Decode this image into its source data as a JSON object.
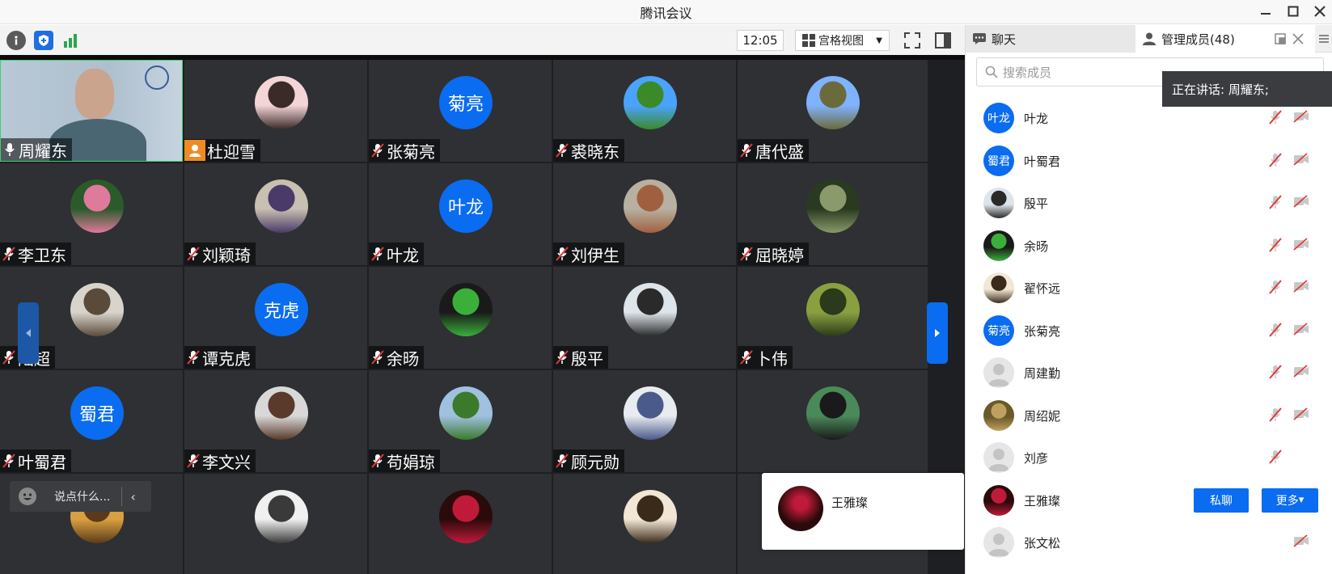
{
  "window": {
    "title": "腾讯会议"
  },
  "toolbar": {
    "time": "12:05",
    "view_label": "宫格视图"
  },
  "grid": {
    "tiles": [
      {
        "name": "周耀东",
        "mic": "on",
        "avatar": {
          "kind": "video"
        }
      },
      {
        "name": "杜迎雪",
        "mic": "none",
        "avatar": {
          "kind": "photo",
          "colors": [
            "#f3d5d8",
            "#3a2a28"
          ]
        }
      },
      {
        "name": "张菊亮",
        "mic": "off",
        "avatar": {
          "kind": "text",
          "text": "菊亮"
        }
      },
      {
        "name": "裘晓东",
        "mic": "off",
        "avatar": {
          "kind": "photo",
          "colors": [
            "#4aa3ff",
            "#3a8a2a"
          ]
        }
      },
      {
        "name": "唐代盛",
        "mic": "off",
        "avatar": {
          "kind": "photo",
          "colors": [
            "#7fb2ff",
            "#6b6a3a"
          ]
        }
      },
      {
        "name": "李卫东",
        "mic": "off",
        "avatar": {
          "kind": "photo",
          "colors": [
            "#2b5a2b",
            "#e07a9a"
          ]
        }
      },
      {
        "name": "刘颖琦",
        "mic": "off",
        "avatar": {
          "kind": "photo",
          "colors": [
            "#c8c0b0",
            "#4a3a6a"
          ]
        }
      },
      {
        "name": "叶龙",
        "mic": "off",
        "avatar": {
          "kind": "text",
          "text": "叶龙"
        }
      },
      {
        "name": "刘伊生",
        "mic": "off",
        "avatar": {
          "kind": "photo",
          "colors": [
            "#b8b0a0",
            "#a06040"
          ]
        }
      },
      {
        "name": "屈晓婷",
        "mic": "off",
        "avatar": {
          "kind": "photo",
          "colors": [
            "#2a3a20",
            "#8a9a6a"
          ]
        }
      },
      {
        "name": "陆超",
        "mic": "off",
        "avatar": {
          "kind": "photo",
          "colors": [
            "#d8d4cc",
            "#5a4a3a"
          ]
        }
      },
      {
        "name": "谭克虎",
        "mic": "off",
        "avatar": {
          "kind": "text",
          "text": "克虎"
        }
      },
      {
        "name": "余旸",
        "mic": "off",
        "avatar": {
          "kind": "photo",
          "colors": [
            "#1a1a1a",
            "#3ab03a"
          ]
        }
      },
      {
        "name": "殷平",
        "mic": "off",
        "avatar": {
          "kind": "photo",
          "colors": [
            "#dde4ea",
            "#2a2a2a"
          ]
        }
      },
      {
        "name": "卜伟",
        "mic": "off",
        "avatar": {
          "kind": "photo",
          "colors": [
            "#8aa040",
            "#2a3a1a"
          ]
        }
      },
      {
        "name": "叶蜀君",
        "mic": "off",
        "avatar": {
          "kind": "text",
          "text": "蜀君"
        }
      },
      {
        "name": "李文兴",
        "mic": "off",
        "avatar": {
          "kind": "photo",
          "colors": [
            "#d8d8d8",
            "#5a3a2a"
          ]
        }
      },
      {
        "name": "苟娟琼",
        "mic": "off",
        "avatar": {
          "kind": "photo",
          "colors": [
            "#a0c0e0",
            "#3a7a2a"
          ]
        }
      },
      {
        "name": "顾元勋",
        "mic": "off",
        "avatar": {
          "kind": "photo",
          "colors": [
            "#e8ecf0",
            "#4a5a8a"
          ]
        }
      },
      {
        "name": "",
        "mic": "none",
        "avatar": {
          "kind": "photo",
          "colors": [
            "#4a8a5a",
            "#1a1a1a"
          ]
        }
      },
      {
        "name": "",
        "mic": "none",
        "avatar": {
          "kind": "photo",
          "colors": [
            "#d8a040",
            "#5a3a1a"
          ]
        }
      },
      {
        "name": "",
        "mic": "none",
        "avatar": {
          "kind": "photo",
          "colors": [
            "#f0f0f0",
            "#3a3a3a"
          ]
        }
      },
      {
        "name": "",
        "mic": "none",
        "avatar": {
          "kind": "photo",
          "colors": [
            "#2a0a0a",
            "#c01a3a"
          ]
        }
      },
      {
        "name": "",
        "mic": "none",
        "avatar": {
          "kind": "photo",
          "colors": [
            "#f2e6d4",
            "#3a2a1a"
          ]
        }
      },
      {
        "name": "",
        "mic": "none",
        "avatar": {
          "kind": "text",
          "text": ""
        }
      }
    ],
    "chat_placeholder": "说点什么...",
    "popup_name": "王雅璨"
  },
  "panel": {
    "tab_chat": "聊天",
    "tab_members": "管理成员(48)",
    "search_placeholder": "搜索成员",
    "speaking": "正在讲话: 周耀东;",
    "members": [
      {
        "name": "叶龙",
        "avatar": {
          "kind": "text",
          "text": "叶龙"
        },
        "mic": "off",
        "cam": "off"
      },
      {
        "name": "叶蜀君",
        "avatar": {
          "kind": "text",
          "text": "蜀君"
        },
        "mic": "off",
        "cam": "off"
      },
      {
        "name": "殷平",
        "avatar": {
          "kind": "photo",
          "colors": [
            "#dde4ea",
            "#2a2a2a"
          ]
        },
        "mic": "off",
        "cam": "off"
      },
      {
        "name": "余旸",
        "avatar": {
          "kind": "photo",
          "colors": [
            "#1a1a1a",
            "#3ab03a"
          ]
        },
        "mic": "off",
        "cam": "off"
      },
      {
        "name": "翟怀远",
        "avatar": {
          "kind": "photo",
          "colors": [
            "#f2e6d4",
            "#3a2a1a"
          ]
        },
        "mic": "off",
        "cam": "off"
      },
      {
        "name": "张菊亮",
        "avatar": {
          "kind": "text",
          "text": "菊亮"
        },
        "mic": "off",
        "cam": "off"
      },
      {
        "name": "周建勤",
        "avatar": {
          "kind": "ghost"
        },
        "mic": "off",
        "cam": "off"
      },
      {
        "name": "周绍妮",
        "avatar": {
          "kind": "photo",
          "colors": [
            "#6a5a2a",
            "#c0a060"
          ]
        },
        "mic": "off",
        "cam": "off"
      },
      {
        "name": "刘彦",
        "avatar": {
          "kind": "ghost"
        },
        "mic": "off",
        "cam": "none"
      },
      {
        "name": "王雅璨",
        "avatar": {
          "kind": "photo",
          "colors": [
            "#2a0a0a",
            "#c01a3a"
          ]
        },
        "mic": "none",
        "cam": "none",
        "actions": true
      },
      {
        "name": "张文松",
        "avatar": {
          "kind": "ghost"
        },
        "mic": "none",
        "cam": "off"
      }
    ],
    "btn_private": "私聊",
    "btn_more": "更多"
  },
  "colors": {
    "accent": "#0a6cf0",
    "tile": "#2e3033"
  }
}
